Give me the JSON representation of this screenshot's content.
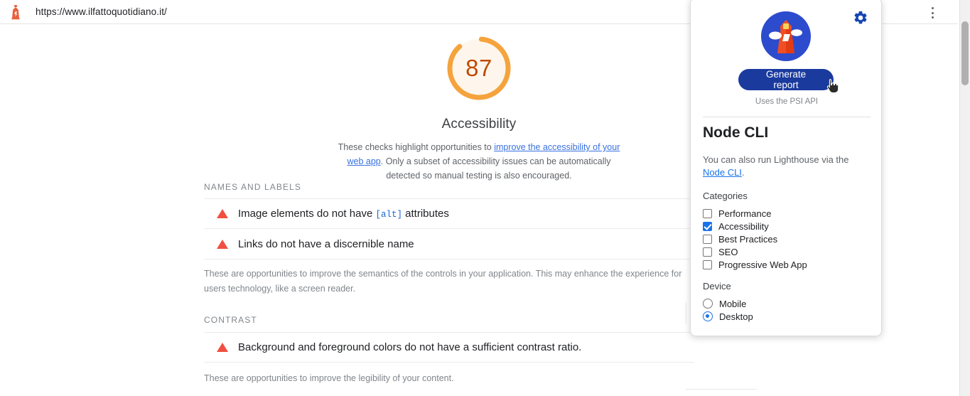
{
  "browser": {
    "url": "https://www.ilfattoquotidiano.it/",
    "favicon_icon": "lighthouse-favicon",
    "menu_icon": "kebab-menu-icon"
  },
  "report": {
    "score": "87",
    "score_color": "#f5a33c",
    "category_title": "Accessibility",
    "description_pre": "These checks highlight opportunities to ",
    "description_link": "improve the accessibility of your web app",
    "description_post": ". Only a subset of accessibility issues can be automatically detected so manual testing is also encouraged.",
    "sections": [
      {
        "heading": "NAMES AND LABELS",
        "audits": [
          {
            "icon": "warning-triangle-icon",
            "text_pre": "Image elements do not have ",
            "code": "[alt]",
            "text_post": " attributes"
          },
          {
            "icon": "warning-triangle-icon",
            "text_pre": "Links do not have a discernible name",
            "code": "",
            "text_post": ""
          }
        ],
        "note": "These are opportunities to improve the semantics of the controls in your application. This may enhance the experience for users technology, like a screen reader."
      },
      {
        "heading": "CONTRAST",
        "audits": [
          {
            "icon": "warning-triangle-icon",
            "text_pre": "Background and foreground colors do not have a sufficient contrast ratio.",
            "code": "",
            "text_post": ""
          }
        ],
        "note": "These are opportunities to improve the legibility of your content."
      }
    ]
  },
  "popup": {
    "logo_icon": "lighthouse-logo-icon",
    "settings_icon": "gear-icon",
    "generate_button": "Generate report",
    "psi_note": "Uses the PSI API",
    "node_cli_title": "Node CLI",
    "node_cli_desc_pre": "You can also run Lighthouse via the ",
    "node_cli_link": "Node CLI",
    "node_cli_desc_post": ".",
    "categories_label": "Categories",
    "categories": [
      {
        "label": "Performance",
        "checked": false
      },
      {
        "label": "Accessibility",
        "checked": true
      },
      {
        "label": "Best Practices",
        "checked": false
      },
      {
        "label": "SEO",
        "checked": false
      },
      {
        "label": "Progressive Web App",
        "checked": false
      }
    ],
    "device_label": "Device",
    "devices": [
      {
        "label": "Mobile",
        "selected": false
      },
      {
        "label": "Desktop",
        "selected": true
      }
    ],
    "cursor_icon": "pointing-hand-cursor-icon"
  },
  "colors": {
    "accent_blue": "#1a73e8",
    "button_blue": "#1a3a9e",
    "warning_red": "#f04f41",
    "score_orange": "#f5a33c"
  }
}
